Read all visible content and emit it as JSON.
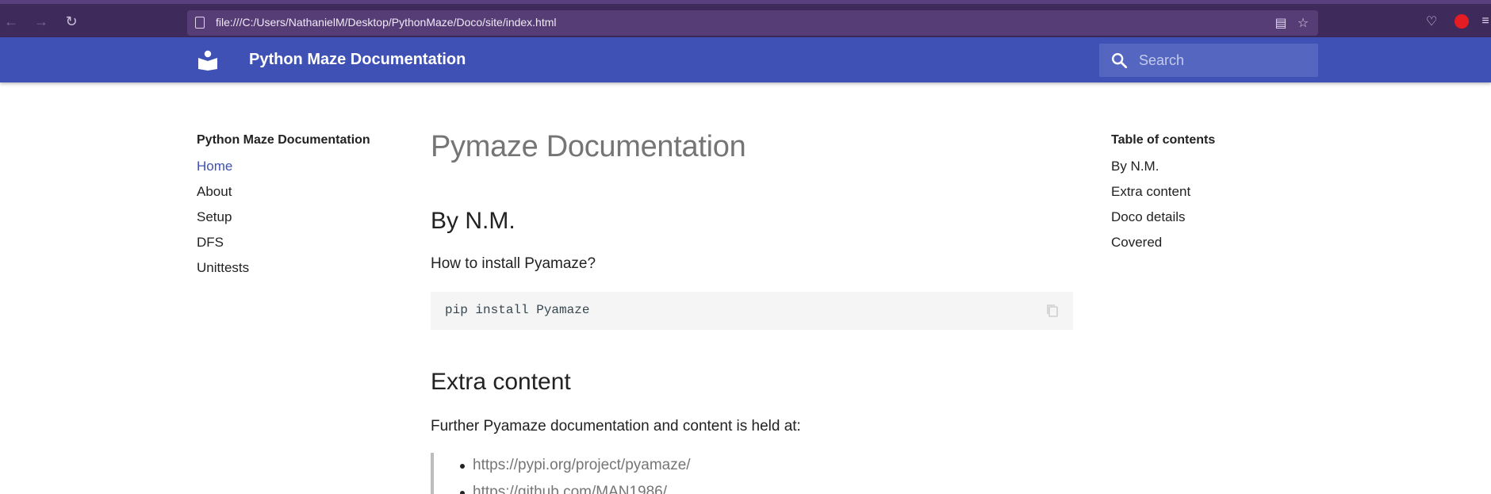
{
  "browser": {
    "url": "file:///C:/Users/NathanielM/Desktop/PythonMaze/Doco/site/index.html",
    "icons": {
      "back": "back-arrow-icon",
      "forward": "forward-arrow-icon",
      "reload": "reload-icon",
      "page_info": "page-icon",
      "reader": "reader-view-icon",
      "bookmark": "star-icon",
      "pocket": "pocket-icon",
      "extension": "extension-icon",
      "menu": "menu-icon"
    }
  },
  "header": {
    "site_title": "Python Maze Documentation",
    "search_placeholder": "Search",
    "brand_color": "#3f51b5"
  },
  "nav": {
    "title": "Python Maze Documentation",
    "items": [
      {
        "label": "Home",
        "active": true
      },
      {
        "label": "About",
        "active": false
      },
      {
        "label": "Setup",
        "active": false
      },
      {
        "label": "DFS",
        "active": false
      },
      {
        "label": "Unittests",
        "active": false
      }
    ]
  },
  "toc": {
    "title": "Table of contents",
    "items": [
      "By N.M.",
      "Extra content",
      "Doco details",
      "Covered"
    ]
  },
  "content": {
    "h1": "Pymaze Documentation",
    "section1_title": "By N.M.",
    "section1_text": "How to install Pyamaze?",
    "code": "pip install Pyamaze",
    "section2_title": "Extra content",
    "section2_text": "Further Pyamaze documentation and content is held at:",
    "links": [
      "https://pypi.org/project/pyamaze/",
      "https://github.com/MAN1986/"
    ]
  }
}
